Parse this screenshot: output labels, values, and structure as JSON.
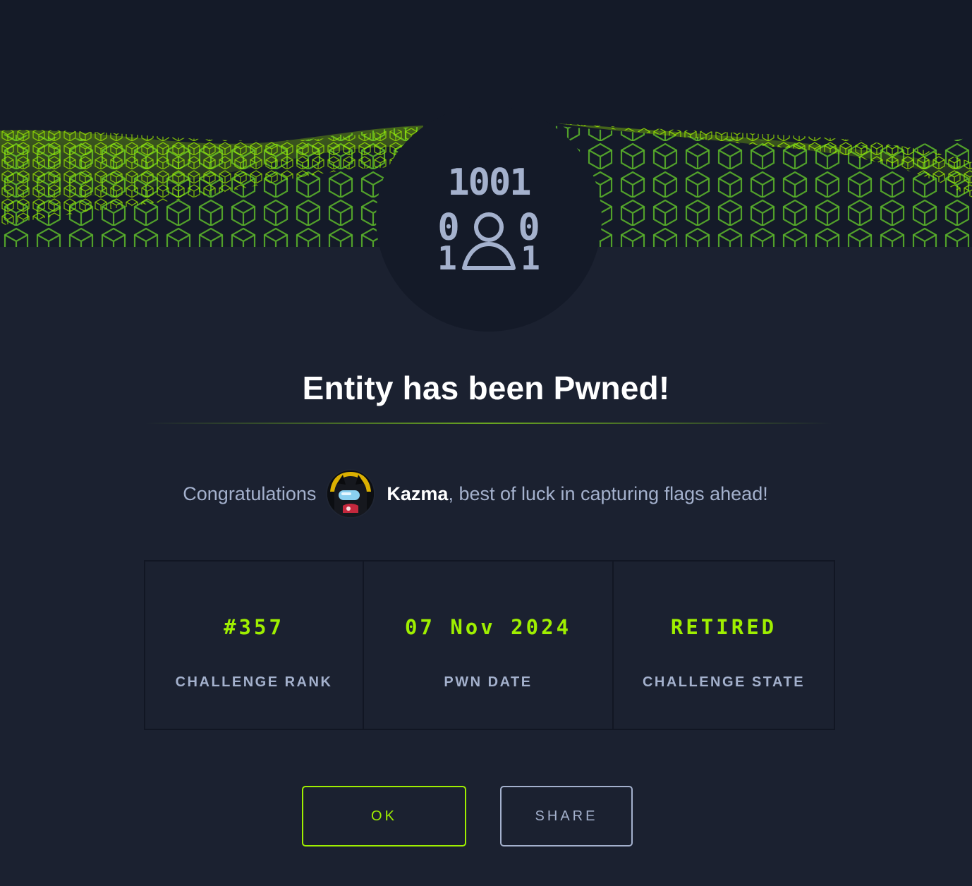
{
  "modal": {
    "title": "Entity has been Pwned!",
    "congrats_prefix": "Congratulations",
    "username": "Kazma",
    "congrats_suffix": ", best of luck in capturing flags ahead!",
    "emblem_icon": "binary-user-icon",
    "emblem_digits": {
      "row1": "1001",
      "row2_left": "0",
      "row2_right": "0",
      "row3_left": "1",
      "row3_right": "1"
    }
  },
  "stats": [
    {
      "value": "#357",
      "label": "CHALLENGE RANK"
    },
    {
      "value": "07 Nov 2024",
      "label": "PWN DATE"
    },
    {
      "value": "RETIRED",
      "label": "CHALLENGE STATE"
    }
  ],
  "buttons": {
    "ok_label": "OK",
    "share_label": "SHARE"
  },
  "colors": {
    "accent": "#9fef00",
    "background": "#1b2130",
    "text_muted": "#a4b1cd",
    "emblem_bg": "#141a28"
  }
}
